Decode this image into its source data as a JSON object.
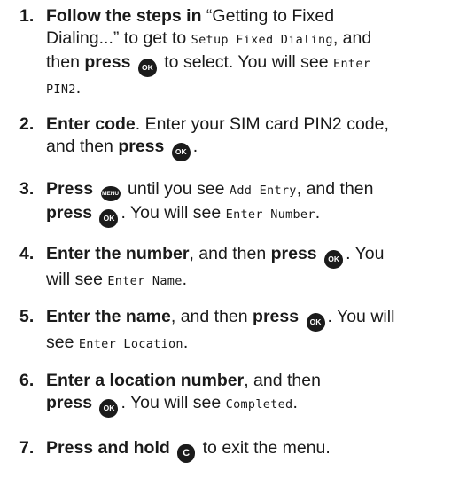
{
  "keys": {
    "ok": "OK",
    "menu": "MENU",
    "c": "C"
  },
  "steps": [
    {
      "num": "1.",
      "t1": "Follow the steps in",
      "t2": " “Getting to Fixed",
      "t3": "Dialing...” to get to ",
      "d1": "Setup Fixed Dialing",
      "t4": ", and",
      "t5": "then ",
      "t6": "press",
      "t7": " to select. You will see ",
      "d2": "Enter",
      "d3": "PIN2",
      "t8": "."
    },
    {
      "num": "2.",
      "t1": "Enter code",
      "t2": ". Enter your SIM card PIN2 code,",
      "t3": "and then ",
      "t4": "press",
      "t5": "."
    },
    {
      "num": "3.",
      "t1": "Press",
      "t2": " until you see ",
      "d1": "Add Entry",
      "t3": ", and then",
      "t4": "press",
      "t5": ". You will see ",
      "d2": "Enter Number",
      "t6": "."
    },
    {
      "num": "4.",
      "t1": "Enter the number",
      "t2": ", and then ",
      "t3": "press",
      "t4": ". You",
      "t5": "will see ",
      "d1": "Enter Name",
      "t6": "."
    },
    {
      "num": "5.",
      "t1": "Enter the name",
      "t2": ", and then ",
      "t3": "press",
      "t4": ". You will",
      "t5": "see ",
      "d1": "Enter Location",
      "t6": "."
    },
    {
      "num": "6.",
      "t1": "Enter a location number",
      "t2": ", and then",
      "t3": "press",
      "t4": ". You will see ",
      "d1": "Completed",
      "t5": "."
    },
    {
      "num": "7.",
      "t1": "Press and hold",
      "t2": " to exit the menu."
    }
  ]
}
